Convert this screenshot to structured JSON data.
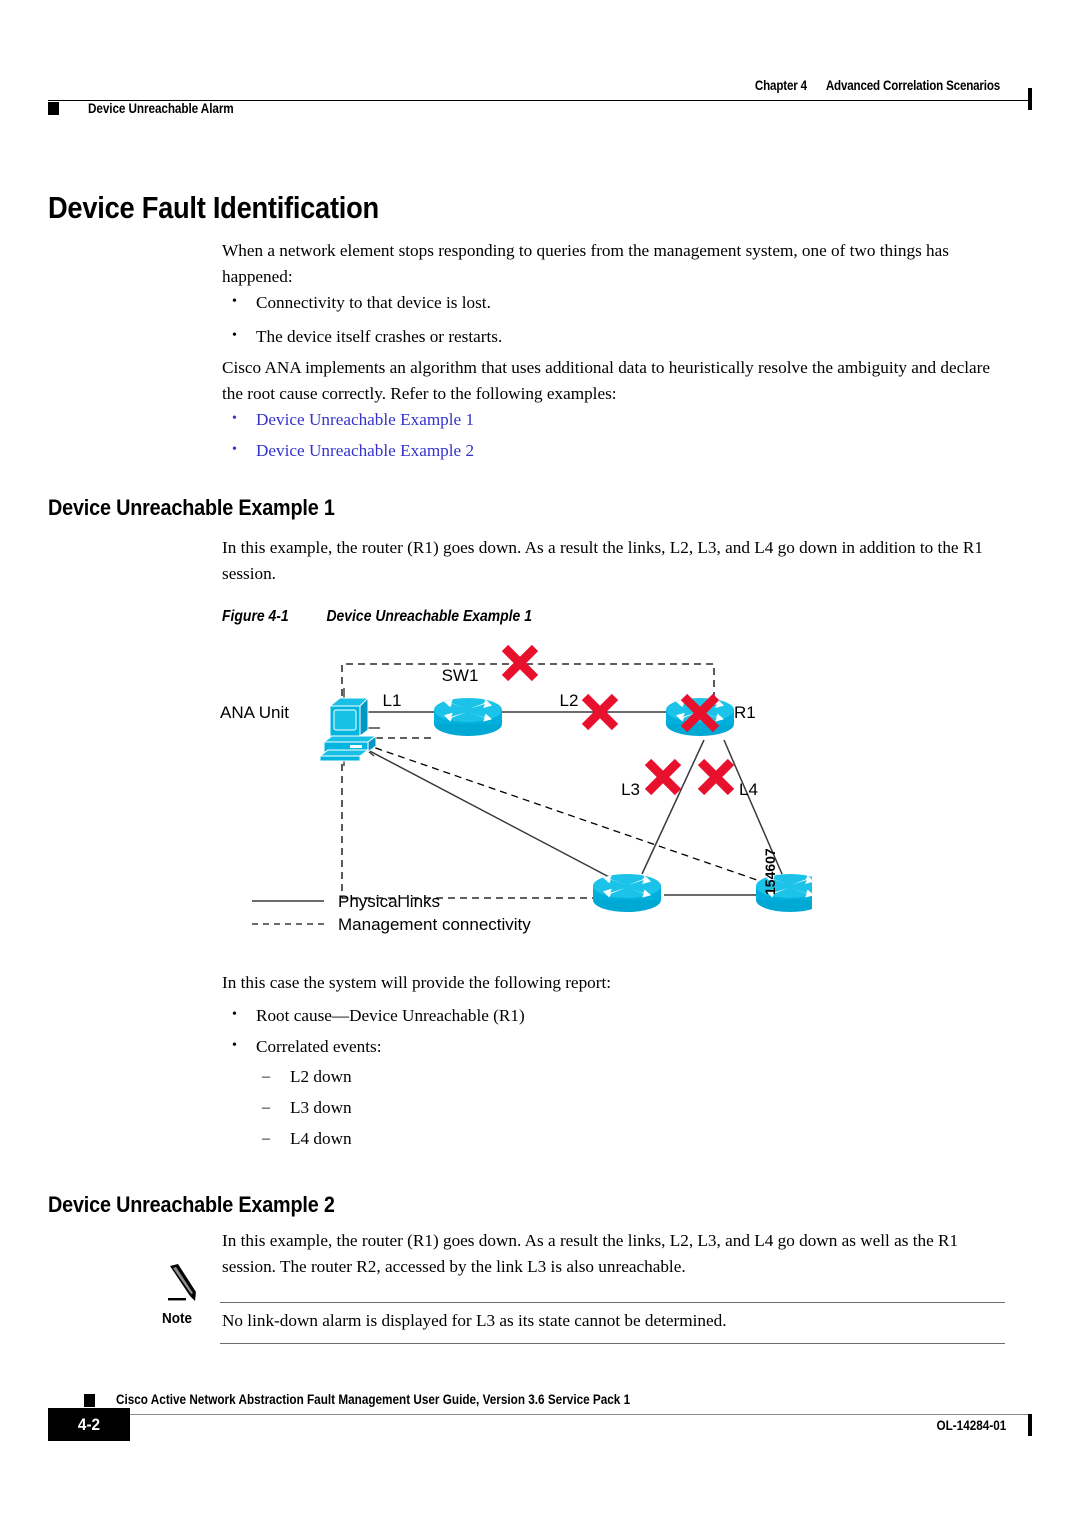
{
  "header": {
    "chapter_label": "Chapter 4",
    "chapter_title": "Advanced Correlation Scenarios",
    "running_head": "Device Unreachable Alarm"
  },
  "sections": {
    "main_title": "Device Fault Identification",
    "intro_paragraph": "When a network element stops responding to queries from the management system, one of two things has happened:",
    "cause_bullets": [
      "Connectivity to that device is lost.",
      "The device itself crashes or restarts."
    ],
    "algorithm_paragraph": "Cisco ANA implements an algorithm that uses additional data to heuristically resolve the ambiguity and declare the root cause correctly. Refer to the following examples:",
    "example_links": [
      "Device Unreachable Example 1",
      "Device Unreachable Example 2"
    ],
    "example1": {
      "heading": "Device Unreachable Example 1",
      "intro": "In this example, the router (R1) goes down. As a result the links, L2, L3, and L4 go down in addition to the R1 session.",
      "report_intro": "In this case the system will provide the following report:",
      "report_bullets": [
        "Root cause—Device Unreachable (R1)",
        "Correlated events:"
      ],
      "correlated_events": [
        "L2 down",
        "L3 down",
        "L4 down"
      ]
    },
    "example2": {
      "heading": "Device Unreachable Example 2",
      "intro": "In this example, the router (R1) goes down. As a result the links, L2, L3, and L4 go down as well as the R1 session. The router R2, accessed by the link L3 is also unreachable."
    }
  },
  "figure": {
    "label": "Figure 4-1",
    "title": "Device Unreachable Example 1",
    "figure_id": "154607",
    "nodes": {
      "ana_unit": "ANA Unit",
      "switch": "SW1",
      "router1": "R1"
    },
    "links": {
      "l1": "L1",
      "l2": "L2",
      "l3": "L3",
      "l4": "L4"
    },
    "legend": [
      "Physical links",
      "Management connectivity"
    ],
    "colors": {
      "device_cyan": "#00B5DF",
      "fault_red": "#E8112D",
      "link_black": "#000000"
    }
  },
  "note": {
    "label": "Note",
    "text": "No link-down alarm is displayed for L3 as its state cannot be determined."
  },
  "footer": {
    "page_number": "4-2",
    "guide_title": "Cisco Active Network Abstraction Fault Management User Guide, Version 3.6 Service Pack 1",
    "doc_id": "OL-14284-01"
  }
}
